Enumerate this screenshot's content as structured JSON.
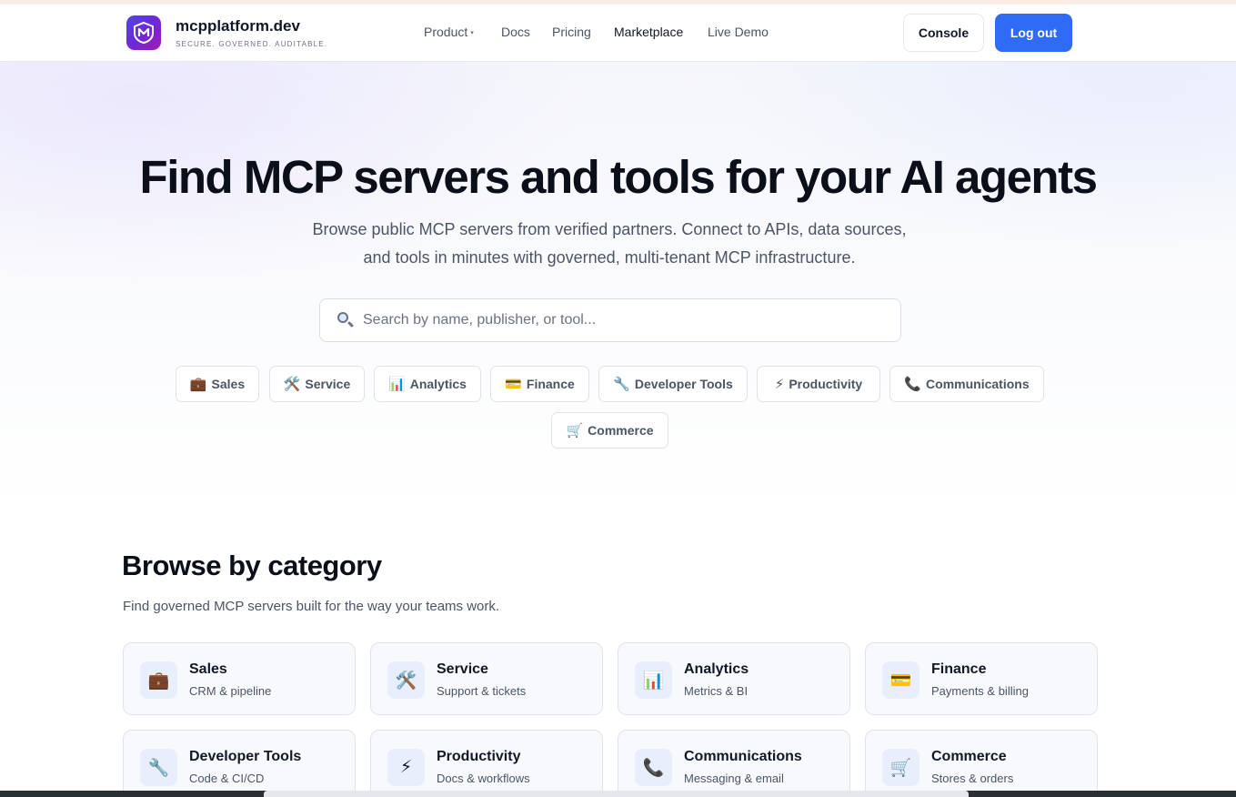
{
  "brand": {
    "name": "mcpplatform.dev",
    "tagline": "SECURE. GOVERNED. AUDITABLE."
  },
  "nav": [
    {
      "label": "Product",
      "has_dropdown": true
    },
    {
      "label": "Docs"
    },
    {
      "label": "Pricing"
    },
    {
      "label": "Marketplace",
      "active": true
    },
    {
      "label": "Live Demo"
    }
  ],
  "header_actions": {
    "console_label": "Console",
    "logout_label": "Log out"
  },
  "hero": {
    "title": "Find MCP servers and tools for your AI agents",
    "subtitle_line1": "Browse public MCP servers from verified partners. Connect to APIs, data sources,",
    "subtitle_line2": "and tools in minutes with governed, multi-tenant MCP infrastructure."
  },
  "search": {
    "placeholder": "Search by name, publisher, or tool...",
    "value": ""
  },
  "chips": [
    {
      "icon": "💼",
      "icon_name": "briefcase-icon",
      "label": "Sales"
    },
    {
      "icon": "🛠️",
      "icon_name": "tools-icon",
      "label": "Service"
    },
    {
      "icon": "📊",
      "icon_name": "bar-chart-icon",
      "label": "Analytics"
    },
    {
      "icon": "💳",
      "icon_name": "credit-card-icon",
      "label": "Finance"
    },
    {
      "icon": "🔧",
      "icon_name": "wrench-icon",
      "label": "Developer Tools"
    },
    {
      "icon": "⚡",
      "icon_name": "lightning-icon",
      "label": "Productivity"
    },
    {
      "icon": "📞",
      "icon_name": "phone-icon",
      "label": "Communications"
    },
    {
      "icon": "🛒",
      "icon_name": "cart-icon",
      "label": "Commerce"
    }
  ],
  "categories_section": {
    "title": "Browse by category",
    "subtitle": "Find governed MCP servers built for the way your teams work.",
    "cards": [
      {
        "icon": "💼",
        "icon_name": "briefcase-icon",
        "name": "Sales",
        "description": "CRM & pipeline"
      },
      {
        "icon": "🛠️",
        "icon_name": "tools-icon",
        "name": "Service",
        "description": "Support & tickets"
      },
      {
        "icon": "📊",
        "icon_name": "bar-chart-icon",
        "name": "Analytics",
        "description": "Metrics & BI"
      },
      {
        "icon": "💳",
        "icon_name": "credit-card-icon",
        "name": "Finance",
        "description": "Payments & billing"
      },
      {
        "icon": "🔧",
        "icon_name": "wrench-icon",
        "name": "Developer Tools",
        "description": "Code & CI/CD"
      },
      {
        "icon": "⚡",
        "icon_name": "lightning-icon",
        "name": "Productivity",
        "description": "Docs & workflows"
      },
      {
        "icon": "📞",
        "icon_name": "phone-icon",
        "name": "Communications",
        "description": "Messaging & email"
      },
      {
        "icon": "🛒",
        "icon_name": "cart-icon",
        "name": "Commerce",
        "description": "Stores & orders"
      }
    ]
  },
  "colors": {
    "primary": "#2f6bf5",
    "logo_gradient_start": "#4f46e5",
    "logo_gradient_end": "#a21caf"
  }
}
